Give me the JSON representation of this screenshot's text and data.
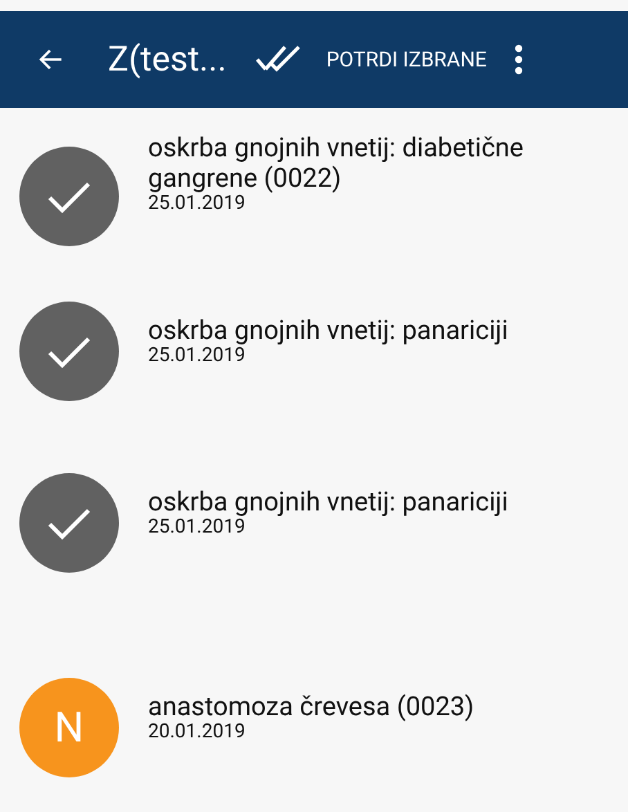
{
  "app_bar": {
    "title": "Z(test...",
    "action": "POTRDI IZBRANE"
  },
  "items": [
    {
      "title": "oskrba gnojnih vnetij: diabetične gangrene (0022)",
      "date": "25.01.2019",
      "selected": true
    },
    {
      "title": "oskrba gnojnih vnetij: panariciji",
      "date": "25.01.2019",
      "selected": true
    },
    {
      "title": "oskrba gnojnih vnetij: panariciji",
      "date": "25.01.2019",
      "selected": true
    },
    {
      "title": "anastomoza črevesa (0023)",
      "date": "20.01.2019",
      "selected": false,
      "letter": "N",
      "color": "#f7941d"
    }
  ]
}
